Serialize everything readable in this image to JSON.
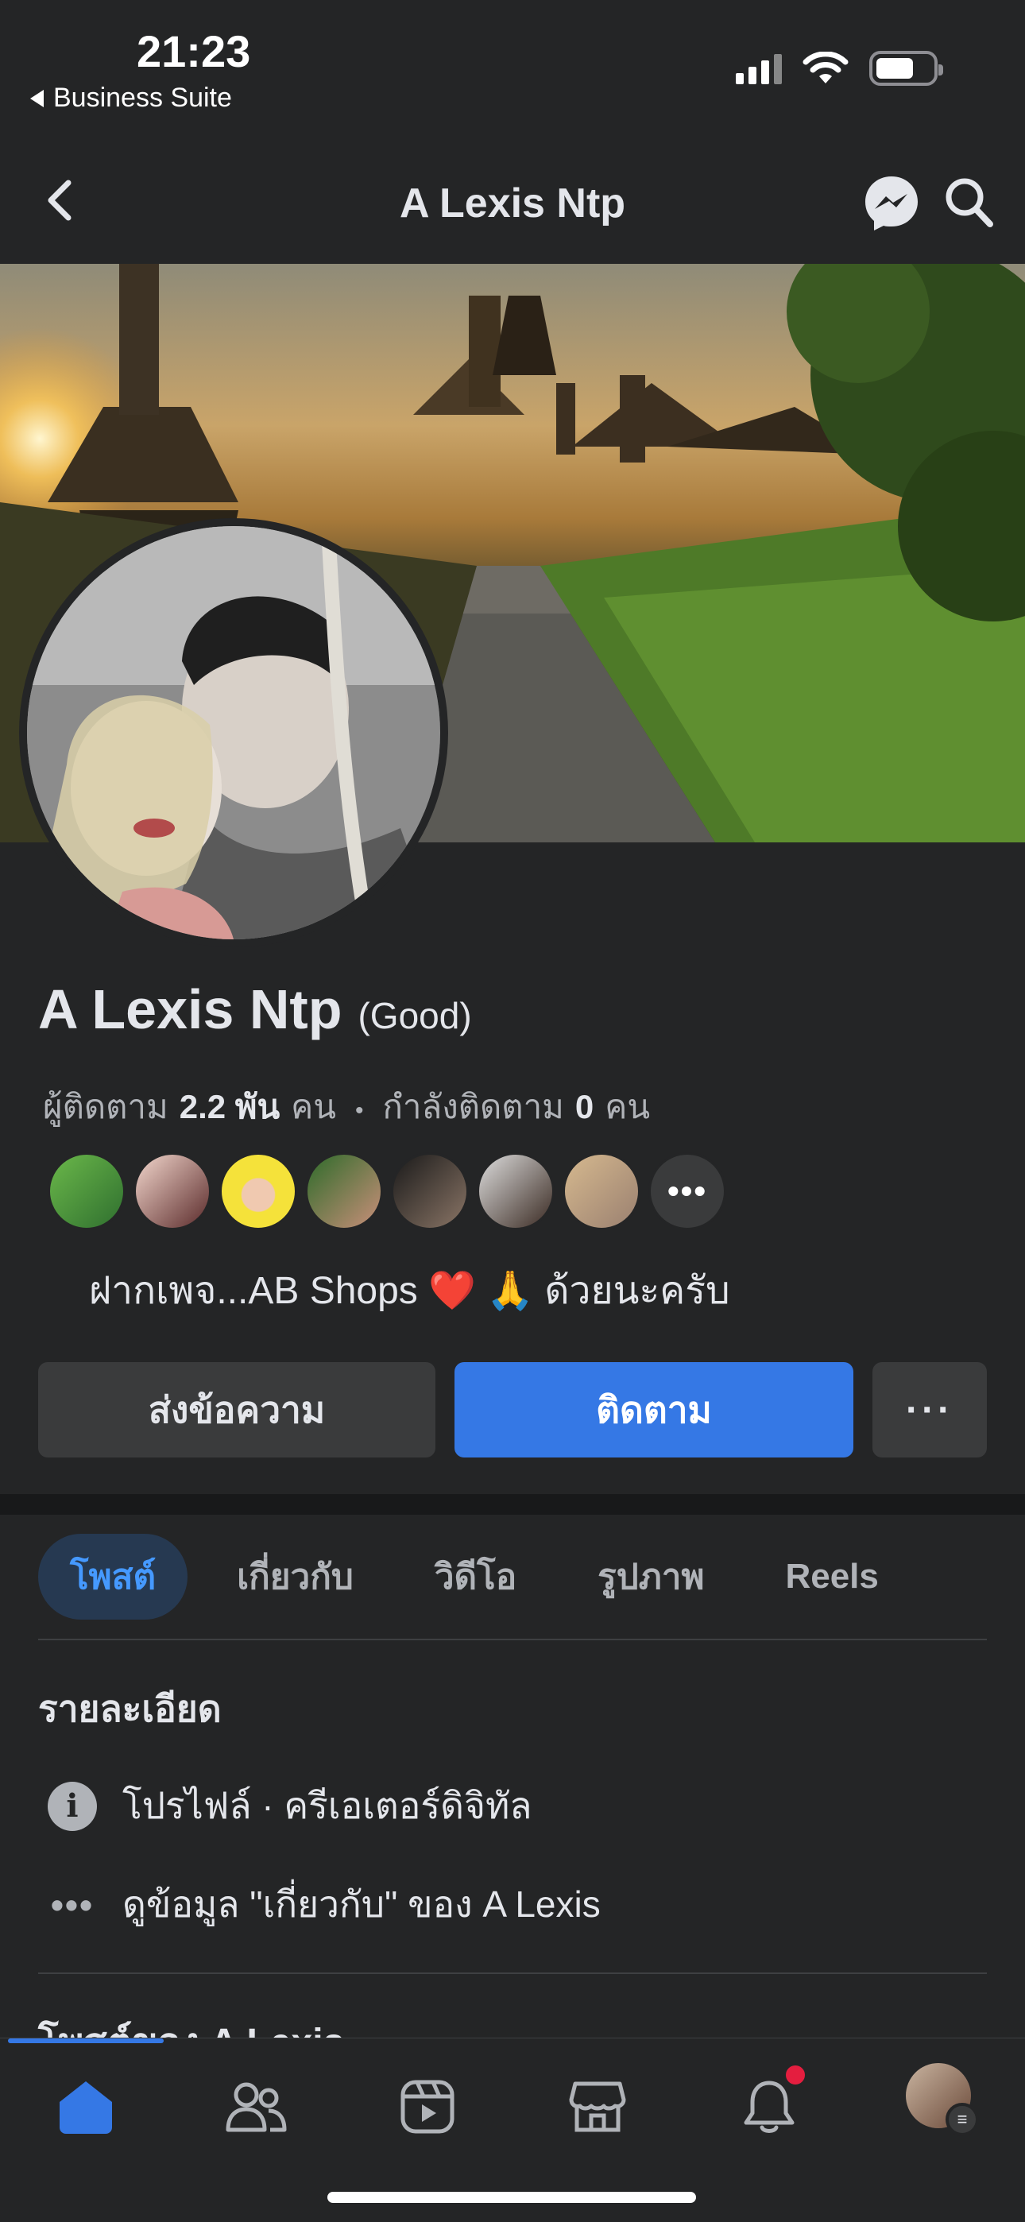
{
  "status_bar": {
    "time": "21:23",
    "back_app": "Business Suite"
  },
  "nav": {
    "title": "A Lexis Ntp",
    "icons": [
      "back-chevron-icon",
      "messenger-icon",
      "search-icon"
    ]
  },
  "profile": {
    "name": "A Lexis Ntp",
    "name_tag": "(Good)",
    "followers_label": "ผู้ติดตาม",
    "followers_count": "2.2 พัน",
    "followers_unit": "คน",
    "following_label": "กำลังติดตาม",
    "following_count": "0",
    "following_unit": "คน",
    "more_friends": "•••",
    "bio": "ฝากเพจ...AB Shops ❤️ 🙏 ด้วยนะครับ"
  },
  "actions": {
    "message": "ส่งข้อความ",
    "follow": "ติดตาม",
    "more": "···"
  },
  "tabs": [
    "โพสต์",
    "เกี่ยวกับ",
    "วิดีโอ",
    "รูปภาพ",
    "Reels"
  ],
  "details": {
    "title": "รายละเอียด",
    "profile_type": "โปรไฟล์ · ครีเอเตอร์ดิจิทัล",
    "see_about": "ดูข้อมูล \"เกี่ยวกับ\" ของ A Lexis",
    "info_icon_glyph": "i",
    "dots_glyph": "•••"
  },
  "posts": {
    "title": "โพสต์ของ A Lexis"
  },
  "bottom_bar": {
    "icons": [
      "home-icon",
      "friends-icon",
      "video-icon",
      "marketplace-icon",
      "bell-icon",
      "profile-avatar"
    ],
    "badge_glyph": "≡"
  },
  "colors": {
    "background": "#242526",
    "accent": "#3578e5",
    "tab_active_bg": "#263951",
    "tab_active_text": "#4599ff",
    "notification": "#e41e3f"
  }
}
